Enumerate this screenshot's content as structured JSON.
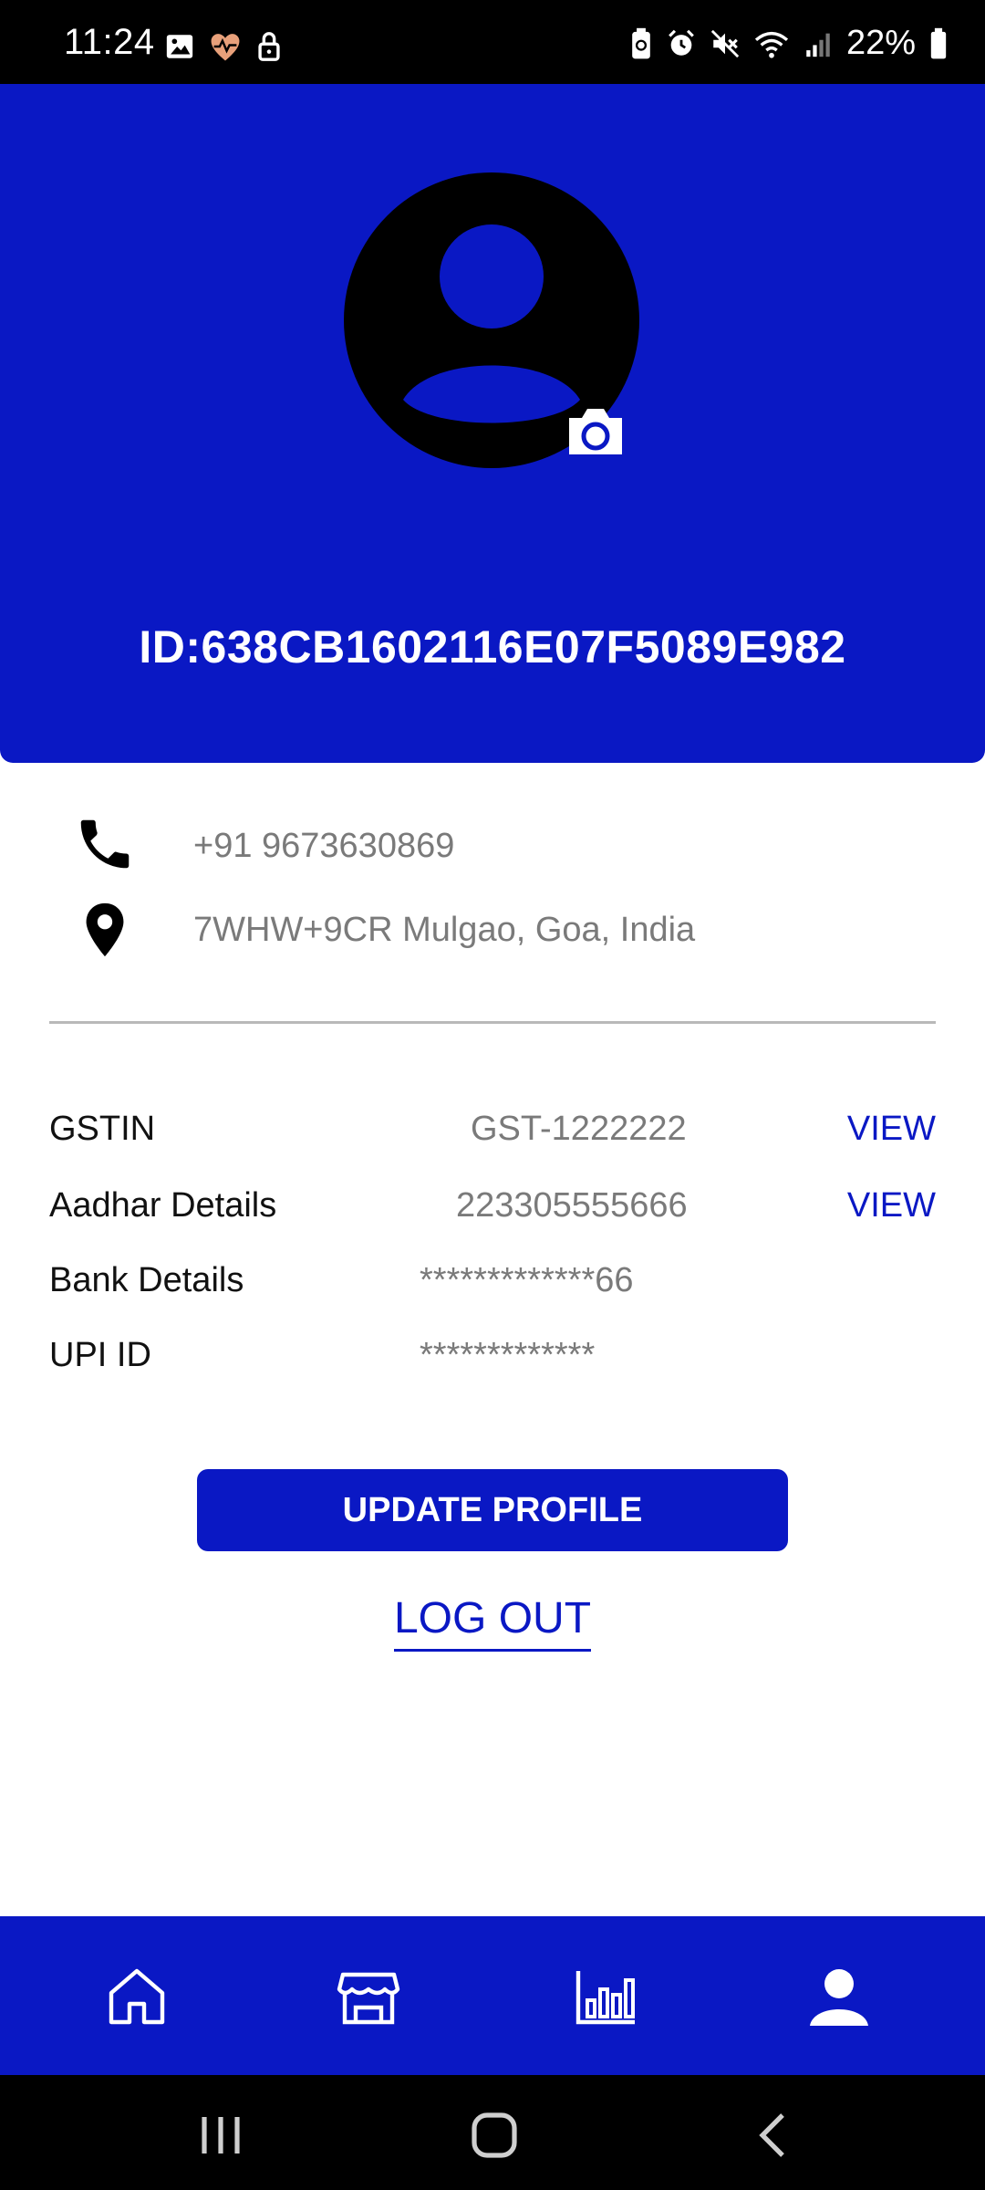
{
  "status_bar": {
    "time": "11:24",
    "battery": "22%",
    "left_icons": [
      "gallery-icon",
      "health-icon",
      "lock-icon"
    ],
    "right_icons": [
      "battery-saver-icon",
      "alarm-icon",
      "mute-icon",
      "wifi-icon",
      "signal-icon",
      "battery-icon"
    ]
  },
  "header": {
    "background_color": "#0a18c4",
    "avatar_icon": "user-avatar-icon",
    "camera_icon": "camera-icon",
    "profile_id": "ID:638CB1602116E07F5089E982"
  },
  "contact": {
    "phone": "+91 9673630869",
    "address": "7WHW+9CR Mulgao, Goa, India"
  },
  "details": {
    "gstin": {
      "label": "GSTIN",
      "value": "GST-1222222",
      "action": "VIEW"
    },
    "aadhar": {
      "label": "Aadhar Details",
      "value": "223305555666",
      "action": "VIEW"
    },
    "bank": {
      "label": "Bank Details",
      "value": "*************66"
    },
    "upi": {
      "label": "UPI ID",
      "value": "*************"
    }
  },
  "actions": {
    "update_profile": "UPDATE PROFILE",
    "log_out": "LOG OUT"
  },
  "bottom_nav": {
    "items": [
      {
        "icon": "home-icon"
      },
      {
        "icon": "store-icon"
      },
      {
        "icon": "analytics-icon"
      },
      {
        "icon": "profile-icon",
        "active": true
      }
    ]
  },
  "system_nav": {
    "items": [
      "recents-icon",
      "home-button-icon",
      "back-icon"
    ]
  }
}
